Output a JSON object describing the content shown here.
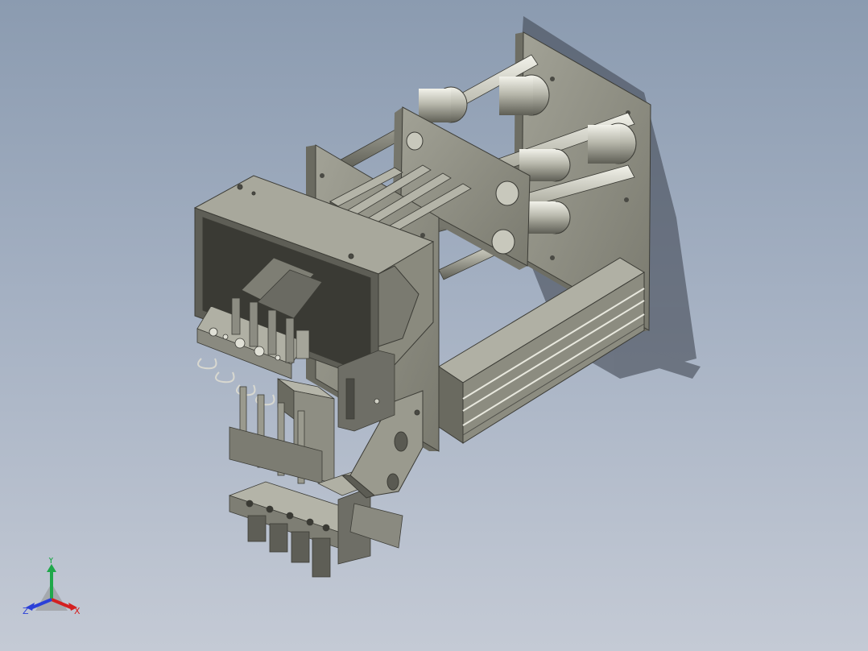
{
  "viewport": {
    "background_top": "#8b9bb0",
    "background_bottom": "#c4cad5",
    "part_color": "#8f8f84",
    "part_shadow": "#4f4f48",
    "shadow_color": "#3a3f4a"
  },
  "triad": {
    "x_label": "X",
    "y_label": "Y",
    "z_label": "Z",
    "x_color": "#d42020",
    "y_color": "#1fa84a",
    "z_color": "#2a3fd8"
  }
}
